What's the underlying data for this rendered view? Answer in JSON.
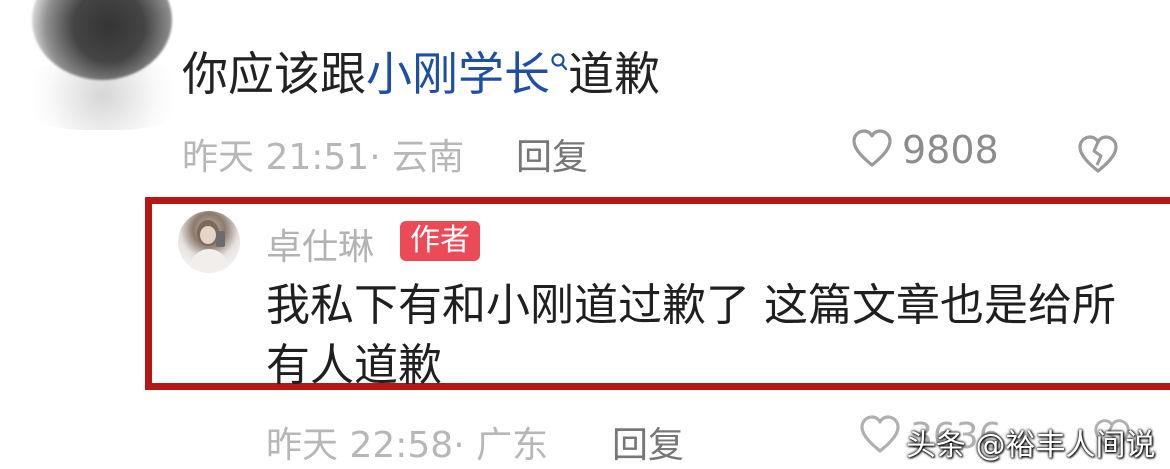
{
  "comment": {
    "text_before": "你应该跟",
    "link_text": "小刚学长",
    "text_after": "道歉",
    "time_location": "昨天 21:51· 云南",
    "reply_label": "回复",
    "like_count": "9808",
    "icons": {
      "search": "search-icon",
      "like": "heart-outline-icon",
      "dislike": "broken-heart-icon"
    }
  },
  "reply": {
    "username": "卓仕琳",
    "badge": "作者",
    "text": "我私下有和小刚道过歉了 这篇文章也是给所有人道歉",
    "time_location": "昨天 22:58· 广东",
    "reply_label": "回复",
    "like_count": "3636"
  },
  "highlight_color": "#b41716",
  "link_color": "#1f4fa3",
  "badge_color": "#ec4a57",
  "watermark": "头条 @裕丰人间说"
}
